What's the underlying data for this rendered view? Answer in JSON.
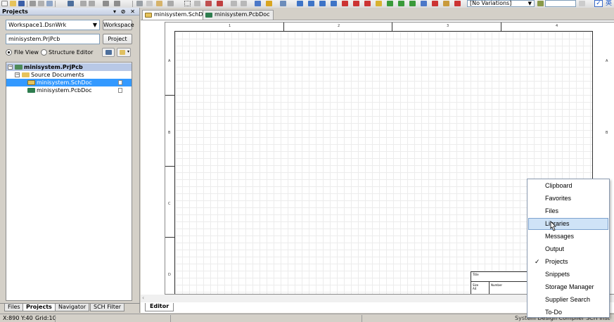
{
  "toolbar": {
    "variations": "[No Variations]",
    "ime_label": "英"
  },
  "panel": {
    "title": "Projects",
    "controls": "▾ ⊘ ✕",
    "workspace_value": "Workspace1.DsnWrk",
    "workspace_button": "Workspace",
    "project_value": "minisystem.PrjPcb",
    "project_button": "Project",
    "view_file": "File View",
    "view_structure": "Structure Editor",
    "tree": {
      "project": "minisystem.PrjPcb",
      "folder": "Source Documents",
      "files": [
        "minisystem.SchDoc",
        "minisystem.PcbDoc"
      ]
    },
    "tabs": [
      "Files",
      "Projects",
      "Navigator",
      "SCH Filter"
    ]
  },
  "doc_tabs": [
    "minisystem.SchDoc",
    "minisystem.PcbDoc"
  ],
  "sheet": {
    "zone_cols": [
      "1",
      "2",
      "3",
      "4"
    ],
    "zone_rows": [
      "A",
      "B",
      "C",
      "D"
    ],
    "titleblock_title": "Title",
    "titleblock_size": "Size",
    "titleblock_size_value": "A4",
    "titleblock_number": "Number"
  },
  "editor_tab": "Editor",
  "status": {
    "coords": "X:890 Y:40",
    "grid": "Grid:10",
    "right_text": "System   Design Compiler   SCH   Inst"
  },
  "menu": {
    "items": [
      "Clipboard",
      "Favorites",
      "Files",
      "Libraries",
      "Messages",
      "Output",
      "Projects",
      "Snippets",
      "Storage Manager",
      "Supplier Search",
      "To-Do"
    ],
    "hover_item": "Libraries",
    "checked_item": "Projects",
    "check_mark": "✓"
  },
  "colors": {
    "selection": "#3399ff",
    "menu_hover": "#cfe3f7",
    "panel_title": "#c7d1e3"
  }
}
